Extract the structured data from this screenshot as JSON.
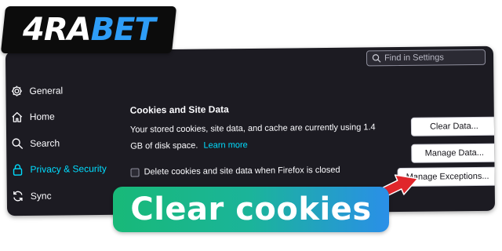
{
  "logo": {
    "part1": "4RA",
    "part2": "BET"
  },
  "search": {
    "placeholder": "Find in Settings"
  },
  "sidebar": {
    "items": [
      {
        "label": "General",
        "icon": "gear-icon",
        "active": false
      },
      {
        "label": "Home",
        "icon": "home-icon",
        "active": false
      },
      {
        "label": "Search",
        "icon": "search-icon",
        "active": false
      },
      {
        "label": "Privacy & Security",
        "icon": "lock-icon",
        "active": true
      },
      {
        "label": "Sync",
        "icon": "sync-icon",
        "active": false
      }
    ]
  },
  "cookies": {
    "title": "Cookies and Site Data",
    "description": "Your stored cookies, site data, and cache are currently using 1.4 GB of disk space.",
    "learn_more": "Learn more",
    "checkbox_label": "Delete cookies and site data when Firefox is closed",
    "clear_button": "Clear Data...",
    "manage_button": "Manage Data...",
    "exceptions_button": "Manage Exceptions..."
  },
  "banner": {
    "text": "Clear cookies"
  },
  "colors": {
    "accent": "#00ddff",
    "arrow": "#e0262b",
    "panel_bg": "#1c1b22"
  }
}
